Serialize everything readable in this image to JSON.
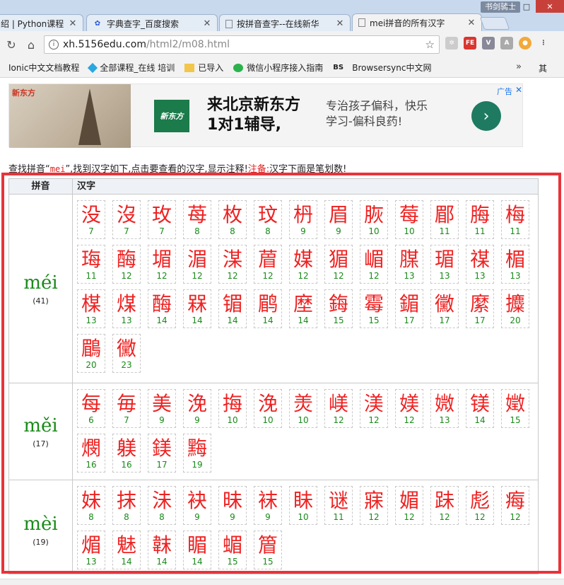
{
  "browser": {
    "tabs": [
      {
        "title": "绍 | Python课程",
        "icon": "generic-icon"
      },
      {
        "title": "字典查字_百度搜索",
        "icon": "baidu-paw-icon"
      },
      {
        "title": "按拼音查字--在线新华",
        "icon": "page-icon"
      },
      {
        "title": "mei拼音的所有汉字",
        "icon": "page-icon"
      }
    ],
    "profile": "书剑骑士",
    "url_host": "xh.5156edu.com",
    "url_path": "/html2/m08.html",
    "bookmarks": [
      {
        "label": "Ionic中文文档教程",
        "icon": "ionic-icon"
      },
      {
        "label": "全部课程_在线 培训",
        "icon": "diamond-icon"
      },
      {
        "label": "已导入",
        "icon": "folder-icon"
      },
      {
        "label": "微信小程序接入指南",
        "icon": "wechat-icon"
      },
      {
        "label": "Browsersync中文网",
        "icon": "bs-icon"
      }
    ],
    "bookmarks_more": "»",
    "bookmarks_tail": "其"
  },
  "ad": {
    "tag": "新东方",
    "logo": "新东方",
    "headline_line1": "来北京新东方",
    "headline_line2": "1对1辅导,",
    "sub_line1": "专治孩子偏科，快乐",
    "sub_line2": "学习-偏科良药!",
    "label": "广告",
    "close": "✕"
  },
  "intro": {
    "prefix": "查找拼音“",
    "keyword": "mei",
    "middle": "”,找到汉字如下,点击要查看的汉字,显示注释!",
    "warn": "注备:",
    "suffix": "汉字下面是笔划数!"
  },
  "table": {
    "headers": {
      "pinyin": "拼音",
      "hanzi": "汉字"
    },
    "rows": [
      {
        "pinyin": "méi",
        "count": "(41)",
        "chars": [
          [
            "没",
            "7"
          ],
          [
            "沒",
            "7"
          ],
          [
            "玫",
            "7"
          ],
          [
            "苺",
            "8"
          ],
          [
            "枚",
            "8"
          ],
          [
            "玟",
            "8"
          ],
          [
            "枬",
            "9"
          ],
          [
            "眉",
            "9"
          ],
          [
            "脄",
            "10"
          ],
          [
            "莓",
            "10"
          ],
          [
            "郿",
            "11"
          ],
          [
            "脢",
            "11"
          ],
          [
            "梅",
            "11"
          ],
          [
            "珻",
            "11"
          ],
          [
            "酶",
            "12"
          ],
          [
            "堳",
            "12"
          ],
          [
            "湄",
            "12"
          ],
          [
            "湈",
            "12"
          ],
          [
            "葿",
            "12"
          ],
          [
            "媒",
            "12"
          ],
          [
            "猸",
            "12"
          ],
          [
            "嵋",
            "12"
          ],
          [
            "腜",
            "13"
          ],
          [
            "瑂",
            "13"
          ],
          [
            "禖",
            "13"
          ],
          [
            "楣",
            "13"
          ],
          [
            "楳",
            "13"
          ],
          [
            "煤",
            "13"
          ],
          [
            "酶",
            "14"
          ],
          [
            "槑",
            "14"
          ],
          [
            "镅",
            "14"
          ],
          [
            "鹛",
            "14"
          ],
          [
            "塺",
            "14"
          ],
          [
            "鋂",
            "15"
          ],
          [
            "霉",
            "15"
          ],
          [
            "鎇",
            "17"
          ],
          [
            "黴",
            "17"
          ],
          [
            "縻",
            "17"
          ],
          [
            "攗",
            "20"
          ],
          [
            "鶥",
            "20"
          ],
          [
            "黴",
            "23"
          ]
        ]
      },
      {
        "pinyin": "měi",
        "count": "(17)",
        "chars": [
          [
            "每",
            "6"
          ],
          [
            "毎",
            "7"
          ],
          [
            "美",
            "9"
          ],
          [
            "浼",
            "9"
          ],
          [
            "挴",
            "10"
          ],
          [
            "浼",
            "10"
          ],
          [
            "羙",
            "10"
          ],
          [
            "嵄",
            "12"
          ],
          [
            "渼",
            "12"
          ],
          [
            "媄",
            "12"
          ],
          [
            "媺",
            "13"
          ],
          [
            "镁",
            "14"
          ],
          [
            "嬍",
            "15"
          ],
          [
            "燘",
            "16"
          ],
          [
            "躾",
            "16"
          ],
          [
            "鎂",
            "17"
          ],
          [
            "黣",
            "19"
          ]
        ]
      },
      {
        "pinyin": "mèi",
        "count": "(19)",
        "chars": [
          [
            "妹",
            "8"
          ],
          [
            "抹",
            "8"
          ],
          [
            "沬",
            "8"
          ],
          [
            "袂",
            "9"
          ],
          [
            "昧",
            "9"
          ],
          [
            "袜",
            "9"
          ],
          [
            "眛",
            "10"
          ],
          [
            "谜",
            "11"
          ],
          [
            "寐",
            "12"
          ],
          [
            "媚",
            "12"
          ],
          [
            "跊",
            "12"
          ],
          [
            "彪",
            "12"
          ],
          [
            "痗",
            "12"
          ],
          [
            "煝",
            "13"
          ],
          [
            "魅",
            "14"
          ],
          [
            "韎",
            "14"
          ],
          [
            "睸",
            "14"
          ],
          [
            "蝞",
            "15"
          ],
          [
            "篃",
            "15"
          ]
        ]
      }
    ]
  },
  "colors": {
    "highlight": "#e8333a",
    "pinyin": "#1a8a1a",
    "hanzi": "#e22"
  }
}
